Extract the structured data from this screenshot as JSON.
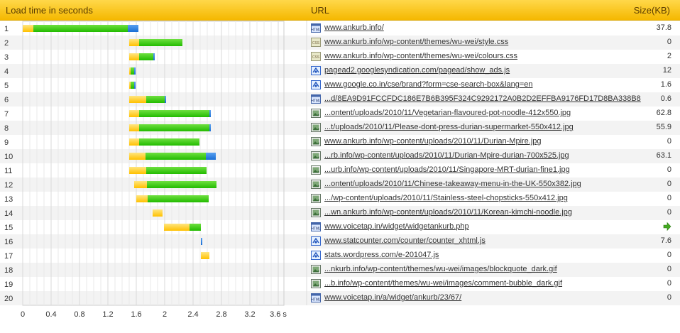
{
  "header": {
    "load_label": "Load time in seconds",
    "url_label": "URL",
    "size_label": "Size(KB)"
  },
  "axis": {
    "ticks": [
      "0",
      "0.4",
      "0.8",
      "1.2",
      "1.6",
      "2",
      "2.4",
      "2.8",
      "3.2",
      "3.6 s"
    ]
  },
  "colors": {
    "connect": "#ffc000",
    "download": "#22bb00",
    "blocking": "#1a6fd4",
    "header": "#ffc828"
  },
  "chart_data": {
    "type": "waterfall",
    "x_unit": "seconds",
    "xlim": [
      0,
      3.8
    ],
    "rows": [
      {
        "n": "1",
        "start": 0.0,
        "wait": 0.15,
        "dl": 1.33,
        "blue": 0.15
      },
      {
        "n": "2",
        "start": 1.5,
        "wait": 0.14,
        "dl": 0.61,
        "blue": 0.0
      },
      {
        "n": "3",
        "start": 1.5,
        "wait": 0.14,
        "dl": 0.2,
        "blue": 0.02
      },
      {
        "n": "4",
        "start": 1.5,
        "wait": 0.02,
        "dl": 0.05,
        "blue": 0.02
      },
      {
        "n": "5",
        "start": 1.5,
        "wait": 0.02,
        "dl": 0.05,
        "blue": 0.02
      },
      {
        "n": "6",
        "start": 1.5,
        "wait": 0.24,
        "dl": 0.26,
        "blue": 0.02
      },
      {
        "n": "7",
        "start": 1.5,
        "wait": 0.14,
        "dl": 0.99,
        "blue": 0.02
      },
      {
        "n": "8",
        "start": 1.5,
        "wait": 0.14,
        "dl": 0.99,
        "blue": 0.02
      },
      {
        "n": "9",
        "start": 1.5,
        "wait": 0.14,
        "dl": 0.85,
        "blue": 0.0
      },
      {
        "n": "10",
        "start": 1.5,
        "wait": 0.23,
        "dl": 0.85,
        "blue": 0.14
      },
      {
        "n": "11",
        "start": 1.5,
        "wait": 0.24,
        "dl": 0.85,
        "blue": 0.0
      },
      {
        "n": "12",
        "start": 1.57,
        "wait": 0.18,
        "dl": 0.98,
        "blue": 0.0
      },
      {
        "n": "13",
        "start": 1.6,
        "wait": 0.16,
        "dl": 0.86,
        "blue": 0.0
      },
      {
        "n": "14",
        "start": 1.83,
        "wait": 0.14,
        "dl": 0.0,
        "blue": 0.0
      },
      {
        "n": "15",
        "start": 1.99,
        "wait": 0.36,
        "dl": 0.16,
        "blue": 0.0
      },
      {
        "n": "16",
        "start": 2.51,
        "wait": 0.0,
        "dl": 0.0,
        "blue": 0.02
      },
      {
        "n": "17",
        "start": 2.51,
        "wait": 0.12,
        "dl": 0.0,
        "blue": 0.0
      },
      {
        "n": "18",
        "start": 0,
        "wait": 0,
        "dl": 0,
        "blue": 0
      },
      {
        "n": "19",
        "start": 0,
        "wait": 0,
        "dl": 0,
        "blue": 0
      },
      {
        "n": "20",
        "start": 0,
        "wait": 0,
        "dl": 0,
        "blue": 0
      }
    ]
  },
  "resources": [
    {
      "icon": "html-file-icon",
      "url": "www.ankurb.info/",
      "size": "37.8"
    },
    {
      "icon": "css-file-icon",
      "url": "www.ankurb.info/wp-content/themes/wu-wei/style.css",
      "size": "0"
    },
    {
      "icon": "css-file-icon",
      "url": "www.ankurb.info/wp-content/themes/wu-wei/colours.css",
      "size": "2"
    },
    {
      "icon": "js-file-icon",
      "url": "pagead2.googlesyndication.com/pagead/show_ads.js",
      "size": "12"
    },
    {
      "icon": "js-file-icon",
      "url": "www.google.co.in/cse/brand?form=cse-search-box&lang=en",
      "size": "1.6"
    },
    {
      "icon": "html-file-icon",
      "url": "...d/8EA9D91FCCFDC186E7B6B395F324C9292172A0B2D2EFFBA9176FD17D8BA338B8",
      "size": "0.6"
    },
    {
      "icon": "image-file-icon",
      "url": "...ontent/uploads/2010/11/Vegetarian-flavoured-pot-noodle-412x550.jpg",
      "size": "62.8"
    },
    {
      "icon": "image-file-icon",
      "url": "...t/uploads/2010/11/Please-dont-press-durian-supermarket-550x412.jpg",
      "size": "55.9"
    },
    {
      "icon": "image-file-icon",
      "url": "www.ankurb.info/wp-content/uploads/2010/11/Durian-Mpire.jpg",
      "size": "0"
    },
    {
      "icon": "image-file-icon",
      "url": "...rb.info/wp-content/uploads/2010/11/Durian-Mpire-durian-700x525.jpg",
      "size": "63.1"
    },
    {
      "icon": "image-file-icon",
      "url": "...urb.info/wp-content/uploads/2010/11/Singapore-MRT-durian-fine1.jpg",
      "size": "0"
    },
    {
      "icon": "image-file-icon",
      "url": "...ontent/uploads/2010/11/Chinese-takeaway-menu-in-the-UK-550x382.jpg",
      "size": "0"
    },
    {
      "icon": "image-file-icon",
      "url": ".../wp-content/uploads/2010/11/Stainless-steel-chopsticks-550x412.jpg",
      "size": "0"
    },
    {
      "icon": "image-file-icon",
      "url": "...wn.ankurb.info/wp-content/uploads/2010/11/Korean-kimchi-noodle.jpg",
      "size": "0"
    },
    {
      "icon": "html-file-icon",
      "url": "www.voicetap.in/widget/widgetankurb.php",
      "size": "",
      "arrow": true
    },
    {
      "icon": "js-file-icon",
      "url": "www.statcounter.com/counter/counter_xhtml.js",
      "size": "7.6"
    },
    {
      "icon": "js-file-icon",
      "url": "stats.wordpress.com/e-201047.js",
      "size": "0"
    },
    {
      "icon": "image-file-icon",
      "url": "...nkurb.info/wp-content/themes/wu-wei/images/blockquote_dark.gif",
      "size": "0"
    },
    {
      "icon": "image-file-icon",
      "url": "...b.info/wp-content/themes/wu-wei/images/comment-bubble_dark.gif",
      "size": "0"
    },
    {
      "icon": "html-file-icon",
      "url": "www.voicetap.in/a/widget/ankurb/23/67/",
      "size": "0"
    }
  ]
}
